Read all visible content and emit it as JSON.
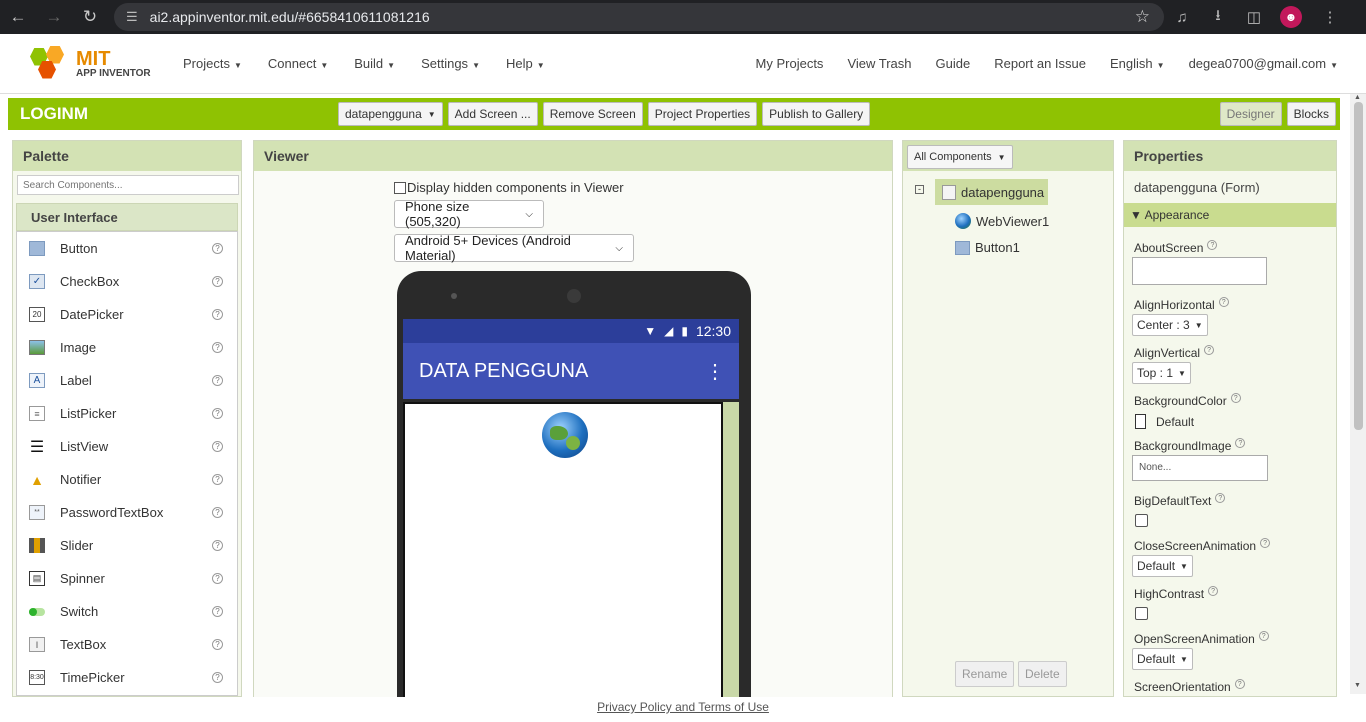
{
  "browser": {
    "url": "ai2.appinventor.mit.edu/#6658410611081216"
  },
  "header": {
    "logo_line1": "MIT",
    "logo_line2": "APP INVENTOR",
    "menus": [
      "Projects",
      "Connect",
      "Build",
      "Settings",
      "Help"
    ],
    "right_links": {
      "my_projects": "My Projects",
      "view_trash": "View Trash",
      "guide": "Guide",
      "report": "Report an Issue",
      "language": "English",
      "account": "degea0700@gmail.com"
    }
  },
  "toolbar": {
    "project_name": "LOGINM",
    "screen_select": "datapengguna",
    "add_screen": "Add Screen ...",
    "remove_screen": "Remove Screen",
    "project_properties": "Project Properties",
    "publish": "Publish to Gallery",
    "designer": "Designer",
    "blocks": "Blocks"
  },
  "palette": {
    "title": "Palette",
    "search_placeholder": "Search Components...",
    "category": "User Interface",
    "items": [
      {
        "label": "Button",
        "icon": "button-icon"
      },
      {
        "label": "CheckBox",
        "icon": "checkbox-icon"
      },
      {
        "label": "DatePicker",
        "icon": "datepicker-icon"
      },
      {
        "label": "Image",
        "icon": "image-icon"
      },
      {
        "label": "Label",
        "icon": "label-icon"
      },
      {
        "label": "ListPicker",
        "icon": "listpicker-icon"
      },
      {
        "label": "ListView",
        "icon": "listview-icon"
      },
      {
        "label": "Notifier",
        "icon": "notifier-icon"
      },
      {
        "label": "PasswordTextBox",
        "icon": "password-icon"
      },
      {
        "label": "Slider",
        "icon": "slider-icon"
      },
      {
        "label": "Spinner",
        "icon": "spinner-icon"
      },
      {
        "label": "Switch",
        "icon": "switch-icon"
      },
      {
        "label": "TextBox",
        "icon": "textbox-icon"
      },
      {
        "label": "TimePicker",
        "icon": "timepicker-icon"
      }
    ]
  },
  "viewer": {
    "title": "Viewer",
    "hidden_label": "Display hidden components in Viewer",
    "size_select": "Phone size (505,320)",
    "theme_select": "Android 5+ Devices (Android Material)",
    "time": "12:30",
    "app_title": "DATA PENGGUNA"
  },
  "components": {
    "filter": "All Components",
    "root": "datapengguna",
    "children": [
      "WebViewer1",
      "Button1"
    ],
    "rename": "Rename",
    "delete": "Delete"
  },
  "properties": {
    "title": "Properties",
    "form_name": "datapengguna (Form)",
    "section": "Appearance",
    "about_screen": "AboutScreen",
    "align_horizontal": "AlignHorizontal",
    "align_horizontal_value": "Center : 3",
    "align_vertical": "AlignVertical",
    "align_vertical_value": "Top : 1",
    "background_color": "BackgroundColor",
    "background_color_value": "Default",
    "background_image": "BackgroundImage",
    "background_image_value": "None...",
    "big_default_text": "BigDefaultText",
    "close_anim": "CloseScreenAnimation",
    "close_anim_value": "Default",
    "high_contrast": "HighContrast",
    "open_anim": "OpenScreenAnimation",
    "open_anim_value": "Default",
    "orientation": "ScreenOrientation"
  },
  "footer": {
    "privacy": "Privacy Policy and Terms of Use"
  }
}
